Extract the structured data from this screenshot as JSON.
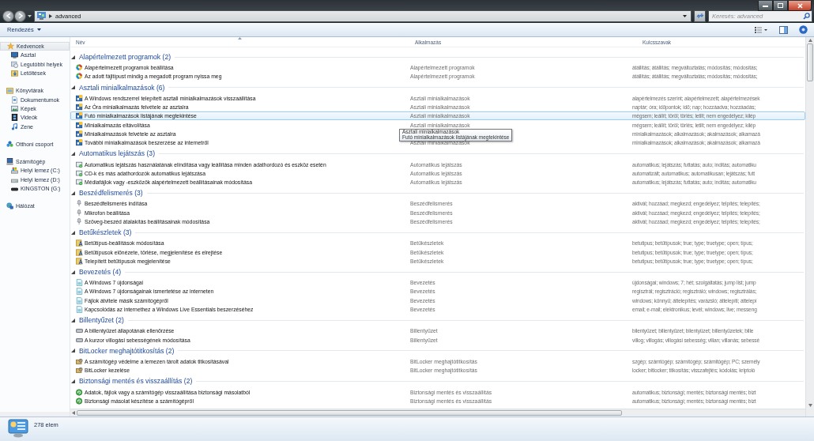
{
  "window": {
    "address": "advanced",
    "search_placeholder": "Keresés: advanced"
  },
  "toolbar": {
    "organize": "Rendezés"
  },
  "navigation": [
    {
      "label": "Kedvencek",
      "kind": "star",
      "selected": true,
      "children": [
        {
          "label": "Asztal",
          "kind": "monitor",
          "selected": false
        },
        {
          "label": "Legutóbbi helyek",
          "kind": "recent",
          "selected": false
        },
        {
          "label": "Letöltések",
          "kind": "download",
          "selected": false
        }
      ]
    },
    {
      "label": "Könyvtárak",
      "kind": "library",
      "selected": false,
      "children": [
        {
          "label": "Dokumentumok",
          "kind": "document",
          "selected": false
        },
        {
          "label": "Képek",
          "kind": "image",
          "selected": false
        },
        {
          "label": "Videók",
          "kind": "film",
          "selected": false
        },
        {
          "label": "Zene",
          "kind": "music",
          "selected": false
        }
      ]
    },
    {
      "label": "Otthoni csoport",
      "kind": "homegroup",
      "selected": false
    },
    {
      "label": "Számítógép",
      "kind": "computer",
      "selected": false,
      "children": [
        {
          "label": "Helyi lemez (C:)",
          "kind": "sysdrive",
          "selected": false
        },
        {
          "label": "Helyi lemez (D:)",
          "kind": "drive",
          "selected": false
        },
        {
          "label": "KINGSTON (G:)",
          "kind": "usb",
          "selected": false
        }
      ]
    },
    {
      "label": "Hálózat",
      "kind": "network",
      "selected": false
    }
  ],
  "columns": [
    "Név",
    "Alkalmazás",
    "Kulcsszavak"
  ],
  "groups": [
    {
      "title": "Alapértelmezett programok (2)",
      "kind": "defaults",
      "expanded": true,
      "items": [
        {
          "name": "Alapértelmezett programok beállítása",
          "app": "Alapértelmezett programok",
          "keywords": "átállítás; átállítás; megváltoztatás; módosítás; módosítás;",
          "selected": false
        },
        {
          "name": "Az adott fájltípust mindig a megadott program nyissa meg",
          "app": "Alapértelmezett programok",
          "keywords": "átállítás; átállítás; megváltoztatás; módosítás; módosítás;",
          "selected": false
        }
      ]
    },
    {
      "title": "Asztali minialkalmazások (6)",
      "kind": "gadgets",
      "expanded": true,
      "items": [
        {
          "name": "A Windows rendszerrel telepített asztali minialkalmazások visszaállítása",
          "app": "Asztali minialkalmazások",
          "keywords": "alapértelmezés szerint; alapértelmezett; alapértelmezések",
          "selected": false
        },
        {
          "name": "Az Óra minialkalmazás felvétele az asztalra",
          "app": "Asztali minialkalmazások",
          "keywords": "naptár; óra; időpontok; idő; nap; hozzáadva; hozzáadás;",
          "selected": false
        },
        {
          "name": "Futó minialkalmazások listájának megtekintése",
          "app": "Asztali minialkalmazások",
          "keywords": "mégsem; leállít; töröl; törlés; letilt; nem engedélyez; kilép",
          "selected": true
        },
        {
          "name": "Minialkalmazás eltávolítása",
          "app": "Asztali minialkalmazások",
          "keywords": "mégsem; leállít; töröl; törlés; letilt; nem engedélyez; kilép",
          "selected": false
        },
        {
          "name": "Minialkalmazások felvétele az asztalra",
          "keywords": "minialkalmazások; alkalmazások; akalmazások; alkamazá",
          "selected": false
        },
        {
          "name": "További minialkalmazások beszerzése az internetről",
          "app": "Asztali minialkalmazások",
          "keywords": "minialkalmazások; alkalmazások; akalmazások; alkamazá",
          "selected": false
        }
      ]
    },
    {
      "title": "Automatikus lejátszás (3)",
      "kind": "autoplay",
      "expanded": true,
      "items": [
        {
          "name": "Automatikus lejátszás használatának elindítása vagy leállítása minden adathordozó és eszköz esetén",
          "app": "Automatikus lejátszás",
          "keywords": "automatikus; lejátszás; futtatás; auto; indítás; automatiku",
          "selected": false
        },
        {
          "name": "CD-k és más adathordozók automatikus lejátszása",
          "app": "Automatikus lejátszás",
          "keywords": "automatizált; automatikus; automatikusan; lejátszás; futt",
          "selected": false
        },
        {
          "name": "Médiafájlok vagy -eszközök alapértelmezett beállításainak módosítása",
          "app": "Automatikus lejátszás",
          "keywords": "automatikus; lejátszás; futtatás; auto; indítás; automatiku",
          "selected": false
        }
      ]
    },
    {
      "title": "Beszédfelismerés (3)",
      "kind": "microphone",
      "expanded": true,
      "items": [
        {
          "name": "Beszédfelismerés indítása",
          "app": "Beszédfelismerés",
          "keywords": "aktivál; hozzáad; megkezd; engedélyez; telpítés; telepítés;",
          "selected": false
        },
        {
          "name": "Mikrofon beállítása",
          "app": "Beszédfelismerés",
          "keywords": "aktivál; hozzáad; megkezd; engedélyez; telpítés; telepítés;",
          "selected": false
        },
        {
          "name": "Szöveg-beszéd átalakítás beállításainak módosítása",
          "app": "Beszédfelismerés",
          "keywords": "aktivál; hozzáad; megkezd; engedélyez; telpítés; telepítés;",
          "selected": false
        }
      ]
    },
    {
      "title": "Betűkészletek (3)",
      "kind": "fonts",
      "expanded": true,
      "items": [
        {
          "name": "Betűtípus-beállítások módosítása",
          "app": "Betűkészletek",
          "keywords": "betutipus; betűtípusok; true; type; truetype; open; típus;",
          "selected": false
        },
        {
          "name": "Betűtípusok előnézete, törlése, megjelenítése és elrejtése",
          "app": "Betűkészletek",
          "keywords": "betutipus; betűtípusok; true; type; truetype; open; típus;",
          "selected": false
        },
        {
          "name": "Telepített betűtípusok megjelenítése",
          "app": "Betűkészletek",
          "keywords": "betutipus; betűtípusok; true; type; truetype; open; típus;",
          "selected": false
        }
      ]
    },
    {
      "title": "Bevezetés (4)",
      "kind": "intro",
      "expanded": true,
      "items": [
        {
          "name": "A Windows 7 újdonságai",
          "app": "Bevezetés",
          "keywords": "újdonságai; windows; 7; hét; szolgáltatás; jump list; jump",
          "selected": false
        },
        {
          "name": "A Windows 7 újdonságainak ismertetése az interneten",
          "app": "Bevezetés",
          "keywords": "regisztrál; regisztráció; regisztráló; windows; regisztrálás;",
          "selected": false
        },
        {
          "name": "Fájlok átvitele másik számítógépről",
          "app": "Bevezetés",
          "keywords": "windows; könnyű; áttelepítés; varázsló; áttelepíti; áttelepí",
          "selected": false
        },
        {
          "name": "Kapcsolódás az internethez a Windows Live Essentials beszerzéséhez",
          "app": "Bevezetés",
          "keywords": "email; e-mail; elektronikus; levél; windows; live; messeng",
          "selected": false
        }
      ]
    },
    {
      "title": "Billentyűzet (2)",
      "kind": "keyboard",
      "expanded": true,
      "items": [
        {
          "name": "A billentyűzet állapotának ellenőrzése",
          "app": "Billentyűzet",
          "keywords": "bilentyűzet; billentyűzet; bilentyüzet; billentyűzetek; bille",
          "selected": false
        },
        {
          "name": "A kurzor villogási sebességének módosítása",
          "app": "Billentyűzet",
          "keywords": "villog; villogás; villogási sebesség; villan; villanás; sebessé",
          "selected": false
        }
      ]
    },
    {
      "title": "BitLocker meghajtótitkosítás (2)",
      "kind": "bitlocker",
      "expanded": true,
      "items": [
        {
          "name": "A számítógép védelme a lemezen tárolt adatok titkosításával",
          "app": "BitLocker meghajtótitkosítás",
          "keywords": "szgép; számtógép; számítógép; számitógép; PC; személy",
          "selected": false
        },
        {
          "name": "BitLocker kezelése",
          "app": "BitLocker meghajtótitkosítás",
          "keywords": "locker; bitlocker; titkosítás; visszafejtés; kódolás; kriptoló",
          "selected": false
        }
      ]
    },
    {
      "title": "Biztonsági mentés és visszaállítás (2)",
      "kind": "backup",
      "expanded": true,
      "items": [
        {
          "name": "Adatok, fájlok vagy a számítógép visszaállítása biztonsági másolatból",
          "app": "Biztonsági mentés és visszaállítás",
          "keywords": "automatikus; biztonsági; mentés; biztonsági mentés; bizt",
          "selected": false
        },
        {
          "name": "Biztonsági másolat készítése a számítógépről",
          "app": "Biztonsági mentés és visszaállítás",
          "keywords": "automatikus; biztonsági; mentés; biztonsági mentés; bizt",
          "selected": false
        }
      ]
    }
  ],
  "tooltip": {
    "title": "Asztali minialkalmazások",
    "text": "Futó minialkalmazások listájának megtekintése"
  },
  "status": {
    "count": "278 elem"
  }
}
